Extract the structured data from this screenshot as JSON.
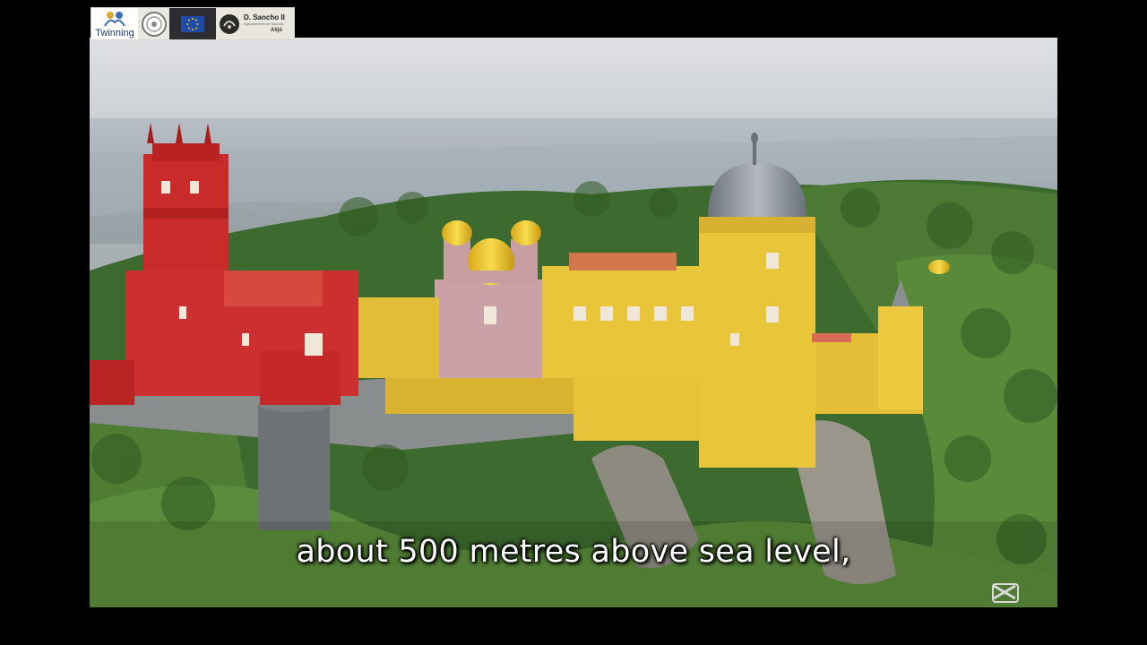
{
  "video": {
    "subtitle": "about 500 metres above sea level,",
    "watermark_icon": "capcut-logo-icon"
  },
  "logos": {
    "twinning": {
      "label": "Twinning",
      "icon": "twinning-figures-icon"
    },
    "seal": {
      "icon": "round-seal-icon"
    },
    "eu": {
      "icon": "eu-flag-icon"
    },
    "school": {
      "name": "D. Sancho II",
      "subtitle": "Agrupamento de Escolas",
      "place": "Alijó",
      "icon": "school-emblem-icon"
    }
  },
  "colors": {
    "castle_red": "#c92a2a",
    "castle_yellow": "#e9c53a",
    "dome_grey": "#8e949c",
    "forest_green": "#3f6a2c",
    "sky": "#d7d9dc",
    "letterbox": "#000000"
  }
}
